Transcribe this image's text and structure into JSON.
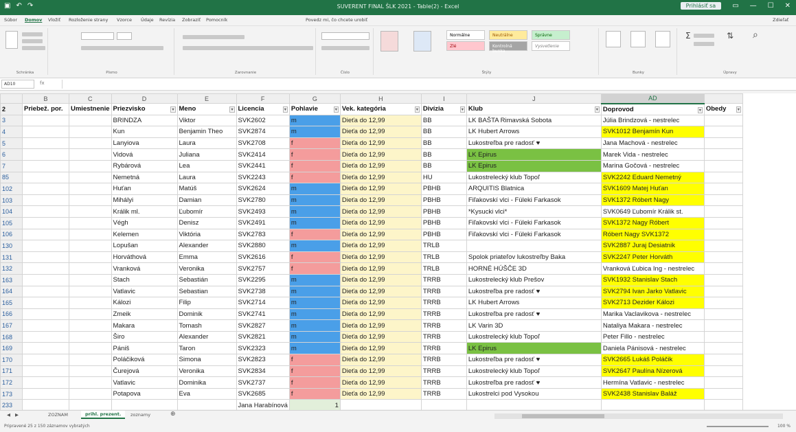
{
  "titlebar": {
    "title": "SUVERENT FINAL ŠLK 2021 - Table(2) - Excel",
    "signin": "Prihlásiť sa",
    "qa_icons": [
      "save-icon",
      "undo-icon",
      "redo-icon"
    ]
  },
  "ribbon": {
    "tabs": [
      "Súbor",
      "Domov",
      "Vložiť",
      "Rozloženie strany",
      "Vzorce",
      "Údaje",
      "Revízia",
      "Zobraziť",
      "Pomocník",
      "Povedz mi, čo chcete urobiť"
    ],
    "share": "Zdieľať",
    "groups": [
      "Schránka",
      "Písmo",
      "Zarovnanie",
      "Číslo",
      "Štýly",
      "Bunky",
      "Úpravy"
    ],
    "styles": {
      "normal": "Normálne",
      "neutral": "Neutrálne",
      "good": "Správne",
      "bad": "Zlé",
      "check": "Kontrolná bunka",
      "explain": "Vysvetlenie"
    }
  },
  "formula_bar": {
    "name_box": "AD10",
    "fx": "fx",
    "formula": ""
  },
  "columns": [
    "",
    "B",
    "C",
    "D",
    "E",
    "F",
    "G",
    "H",
    "I",
    "J",
    "AD",
    ""
  ],
  "selected_column": "AD",
  "headers": [
    "2",
    "Priebež. por.",
    "Umiestnenie",
    "Priezvisko",
    "Meno",
    "Licencia",
    "Pohlavie",
    "Vek. kategória",
    "Divízia",
    "Klub",
    "Doprovod",
    "Obedy"
  ],
  "rows": [
    {
      "n": "3",
      "prz": "BRINDZA",
      "meno": "Viktor",
      "lic": "SVK2602",
      "poh": "m",
      "vek": "Dieťa do 12,99",
      "div": "BB",
      "klub": "LK BAŠTA Rimavská Sobota",
      "klub_cls": "",
      "dop": "Júlia Brindzová - nestrelec",
      "dop_cls": ""
    },
    {
      "n": "4",
      "prz": "Kun",
      "meno": "Benjamin Theo",
      "lic": "SVK2874",
      "poh": "m",
      "vek": "Dieťa do 12,99",
      "div": "BB",
      "klub": "LK Hubert Arrows",
      "klub_cls": "",
      "dop": "SVK1012 Benjamín Kun",
      "dop_cls": "yel"
    },
    {
      "n": "5",
      "prz": "Lanyiova",
      "meno": "Laura",
      "lic": "SVK2708",
      "poh": "f",
      "vek": "Dieťa do 12,99",
      "div": "BB",
      "klub": "Lukostreľba pre radosť ♥",
      "klub_cls": "",
      "dop": "Jana Machová - nestrelec",
      "dop_cls": ""
    },
    {
      "n": "6",
      "prz": "Vidová",
      "meno": "Juliana",
      "lic": "SVK2414",
      "poh": "f",
      "vek": "Dieťa do 12,99",
      "div": "BB",
      "klub": "LK Epirus",
      "klub_cls": "grn",
      "dop": "Marek Vida - nestrelec",
      "dop_cls": ""
    },
    {
      "n": "7",
      "prz": "Rybárová",
      "meno": "Lea",
      "lic": "SVK2441",
      "poh": "f",
      "vek": "Dieťa do 12,99",
      "div": "BB",
      "klub": "LK Epirus",
      "klub_cls": "grn",
      "dop": "Marina Gočová - nestrelec",
      "dop_cls": ""
    },
    {
      "n": "85",
      "prz": "Nemetná",
      "meno": "Laura",
      "lic": "SVK2243",
      "poh": "f",
      "vek": "Dieťa do 12,99",
      "div": "HU",
      "klub": "Lukostrelecký klub Topoľ",
      "klub_cls": "",
      "dop": "SVK2242 Eduard Nemetný",
      "dop_cls": "yel"
    },
    {
      "n": "102",
      "prz": "Huťan",
      "meno": "Matúš",
      "lic": "SVK2624",
      "poh": "m",
      "vek": "Dieťa do 12,99",
      "div": "PBHB",
      "klub": "ARQUITIS Blatnica",
      "klub_cls": "",
      "dop": "SVK1609 Matej Huťan",
      "dop_cls": "yel"
    },
    {
      "n": "103",
      "prz": "Mihályi",
      "meno": "Damian",
      "lic": "SVK2780",
      "poh": "m",
      "vek": "Dieťa do 12,99",
      "div": "PBHB",
      "klub": "Fiľakovskí vlci - Füleki Farkasok",
      "klub_cls": "",
      "dop": "SVK1372 Róbert Nagy",
      "dop_cls": "yel"
    },
    {
      "n": "104",
      "prz": "Králik ml.",
      "meno": "Ľubomír",
      "lic": "SVK2493",
      "poh": "m",
      "vek": "Dieťa do 12,99",
      "div": "PBHB",
      "klub": "*Kysucki vlci*",
      "klub_cls": "",
      "dop": "SVK0649 Ľubomír Králik st.",
      "dop_cls": ""
    },
    {
      "n": "105",
      "prz": "Végh",
      "meno": "Denisz",
      "lic": "SVK2491",
      "poh": "m",
      "vek": "Dieťa do 12,99",
      "div": "PBHB",
      "klub": "Fiľakovskí vlci - Füleki Farkasok",
      "klub_cls": "",
      "dop": "SVK1372 Nagy Róbert",
      "dop_cls": "yel"
    },
    {
      "n": "106",
      "prz": "Kelemen",
      "meno": "Viktória",
      "lic": "SVK2783",
      "poh": "f",
      "vek": "Dieťa do 12,99",
      "div": "PBHB",
      "klub": "Fiľakovskí vlci - Füleki Farkasok",
      "klub_cls": "",
      "dop": "Róbert Nagy SVK1372",
      "dop_cls": "yel"
    },
    {
      "n": "130",
      "prz": "Lopušan",
      "meno": "Alexander",
      "lic": "SVK2880",
      "poh": "m",
      "vek": "Dieťa do 12,99",
      "div": "TRLB",
      "klub": "",
      "klub_cls": "",
      "dop": "SVK2887 Juraj Desiatnik",
      "dop_cls": "yel"
    },
    {
      "n": "131",
      "prz": "Horváthová",
      "meno": "Emma",
      "lic": "SVK2616",
      "poh": "f",
      "vek": "Dieťa do 12,99",
      "div": "TRLB",
      "klub": "Spolok priateľov lukostreľby Baka",
      "klub_cls": "",
      "dop": "SVK2247 Peter Horváth",
      "dop_cls": "yel"
    },
    {
      "n": "132",
      "prz": "Vranková",
      "meno": "Veronika",
      "lic": "SVK2757",
      "poh": "f",
      "vek": "Dieťa do 12,99",
      "div": "TRLB",
      "klub": "HORNÉ HÚŠČE 3D",
      "klub_cls": "",
      "dop": "Vranková Ľubica Ing - nestrelec",
      "dop_cls": ""
    },
    {
      "n": "163",
      "prz": "Stach",
      "meno": "Sebastián",
      "lic": "SVK2295",
      "poh": "m",
      "vek": "Dieťa do 12,99",
      "div": "TRRB",
      "klub": "Lukostrelecký klub Prešov",
      "klub_cls": "",
      "dop": "SVK1932 Stanislav Stach",
      "dop_cls": "yel"
    },
    {
      "n": "164",
      "prz": "Vatlavic",
      "meno": "Sebastian",
      "lic": "SVK2738",
      "poh": "m",
      "vek": "Dieťa do 12,99",
      "div": "TRRB",
      "klub": "Lukostreľba pre radosť ♥",
      "klub_cls": "",
      "dop": "SVK2794 Ivan Jarko Vatlavic",
      "dop_cls": "yel"
    },
    {
      "n": "165",
      "prz": "Kálozi",
      "meno": "Filip",
      "lic": "SVK2714",
      "poh": "m",
      "vek": "Dieťa do 12,99",
      "div": "TRRB",
      "klub": "LK Hubert Arrows",
      "klub_cls": "",
      "dop": "SVK2713 Dezider Kálozi",
      "dop_cls": "yel"
    },
    {
      "n": "166",
      "prz": "Zmeik",
      "meno": "Dominik",
      "lic": "SVK2741",
      "poh": "m",
      "vek": "Dieťa do 12,99",
      "div": "TRRB",
      "klub": "Lukostreľba pre radosť ♥",
      "klub_cls": "",
      "dop": "Marika Vaclavikova - nestrelec",
      "dop_cls": ""
    },
    {
      "n": "167",
      "prz": "Makara",
      "meno": "Tomash",
      "lic": "SVK2827",
      "poh": "m",
      "vek": "Dieťa do 12,99",
      "div": "TRRB",
      "klub": "LK Varin 3D",
      "klub_cls": "",
      "dop": "Nataliya Makara - nestrelec",
      "dop_cls": ""
    },
    {
      "n": "168",
      "prz": "Širo",
      "meno": "Alexander",
      "lic": "SVK2821",
      "poh": "m",
      "vek": "Dieťa do 12,99",
      "div": "TRRB",
      "klub": "Lukostrelecký klub Topoľ",
      "klub_cls": "",
      "dop": "Peter Fillo - nestrelec",
      "dop_cls": ""
    },
    {
      "n": "169",
      "prz": "Pániš",
      "meno": "Taron",
      "lic": "SVK2323",
      "poh": "m",
      "vek": "Dieťa do 12,99",
      "div": "TRRB",
      "klub": "LK Epirus",
      "klub_cls": "grn",
      "dop": "Daniela Pánisová - nestrelec",
      "dop_cls": ""
    },
    {
      "n": "170",
      "prz": "Poláčiková",
      "meno": "Simona",
      "lic": "SVK2823",
      "poh": "f",
      "vek": "Dieťa do 12,99",
      "div": "TRRB",
      "klub": "Lukostreľba pre radosť ♥",
      "klub_cls": "",
      "dop": "SVK2665 Lukáš Poláčik",
      "dop_cls": "yel"
    },
    {
      "n": "171",
      "prz": "Čurejová",
      "meno": "Veronika",
      "lic": "SVK2834",
      "poh": "f",
      "vek": "Dieťa do 12,99",
      "div": "TRRB",
      "klub": "Lukostrelecký klub Topoľ",
      "klub_cls": "",
      "dop": "SVK2647 Paulína Nízerová",
      "dop_cls": "yel"
    },
    {
      "n": "172",
      "prz": "Vatlavic",
      "meno": "Dominika",
      "lic": "SVK2737",
      "poh": "f",
      "vek": "Dieťa do 12,99",
      "div": "TRRB",
      "klub": "Lukostreľba pre radosť ♥",
      "klub_cls": "",
      "dop": "Hermína Vatlavic - nestrelec",
      "dop_cls": ""
    },
    {
      "n": "173",
      "prz": "Potapova",
      "meno": "Eva",
      "lic": "SVK2685",
      "poh": "f",
      "vek": "Dieťa do 12,99",
      "div": "TRRB",
      "klub": "Lukostrelci pod Vysokou",
      "klub_cls": "",
      "dop": "SVK2438 Stanislav Baláž",
      "dop_cls": "yel"
    }
  ],
  "total_row": {
    "n": "233",
    "lic": "Jana Harabínová",
    "poh": "1"
  },
  "sheet_tabs": [
    "ZOZNAM",
    "prihl. prezent.",
    "zoznamy"
  ],
  "status": {
    "left": "Pripravené   25 z 150 záznamov vybratých",
    "zoom": "100 %"
  }
}
